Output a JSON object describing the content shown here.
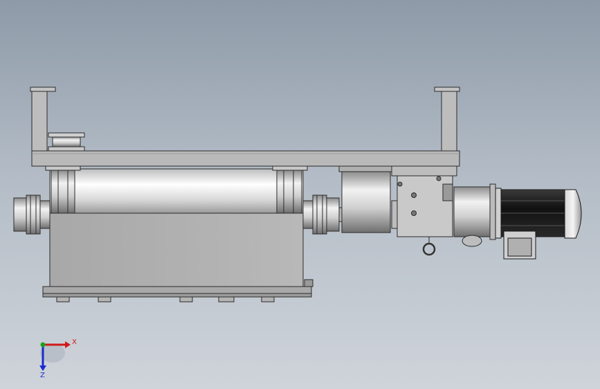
{
  "view": {
    "triad": {
      "x_label": "X",
      "z_label": "Z",
      "x_color": "#d11a1a",
      "y_color": "#19a319",
      "z_color": "#1a2bd1"
    },
    "colors": {
      "metal": "#c8c8c8",
      "metal_dark": "#8a8a8a",
      "outline": "#2a2a2a",
      "motor_fins": "#1a1a1a"
    }
  }
}
